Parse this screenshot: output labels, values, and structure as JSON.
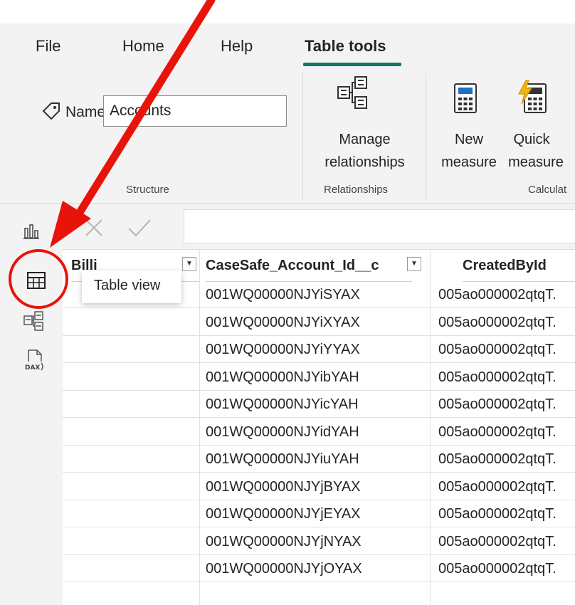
{
  "ribbon_tabs": [
    "File",
    "Home",
    "Help",
    "Table tools"
  ],
  "structure": {
    "name_label": "Name",
    "name_value": "Accounts",
    "group_label": "Structure"
  },
  "relationships": {
    "button_label_1": "Manage",
    "button_label_2": "relationships",
    "group_label": "Relationships"
  },
  "calculations": {
    "new_measure_1": "New",
    "new_measure_2": "measure",
    "quick_measure_1": "Quick",
    "quick_measure_2": "measure",
    "group_label": "Calculat"
  },
  "tooltip": "Table view",
  "table": {
    "headers": [
      "Billi",
      "CaseSafe_Account_Id__c",
      "CreatedById"
    ],
    "rows": [
      [
        "001WQ00000NJYiSYAX",
        "005ao000002qtqT."
      ],
      [
        "001WQ00000NJYiXYAX",
        "005ao000002qtqT."
      ],
      [
        "001WQ00000NJYiYYAX",
        "005ao000002qtqT."
      ],
      [
        "001WQ00000NJYibYAH",
        "005ao000002qtqT."
      ],
      [
        "001WQ00000NJYicYAH",
        "005ao000002qtqT."
      ],
      [
        "001WQ00000NJYidYAH",
        "005ao000002qtqT."
      ],
      [
        "001WQ00000NJYiuYAH",
        "005ao000002qtqT."
      ],
      [
        "001WQ00000NJYjBYAX",
        "005ao000002qtqT."
      ],
      [
        "001WQ00000NJYjEYAX",
        "005ao000002qtqT."
      ],
      [
        "001WQ00000NJYjNYAX",
        "005ao000002qtqT."
      ],
      [
        "001WQ00000NJYjOYAX",
        "005ao000002qtqT."
      ]
    ]
  },
  "colors": {
    "accent": "#117865",
    "annotation": "#e8140a"
  }
}
